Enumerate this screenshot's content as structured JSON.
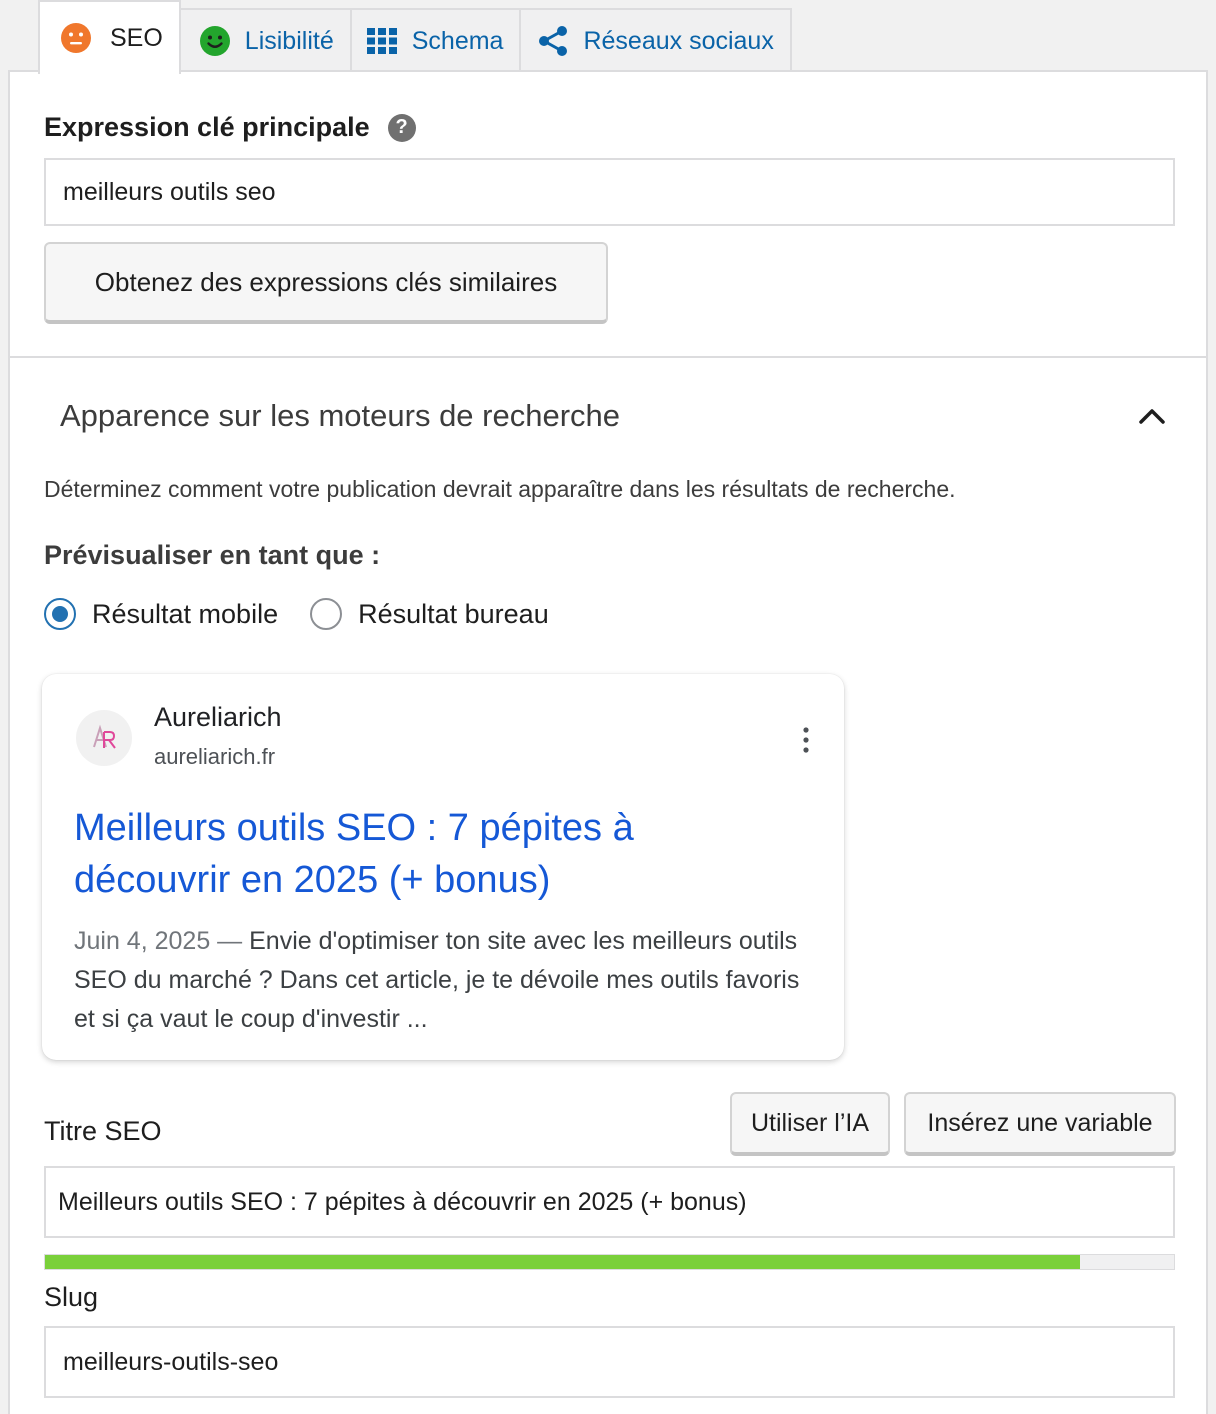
{
  "tabs": [
    {
      "label": "SEO",
      "icon": "orange-neutral-face-icon",
      "active": true
    },
    {
      "label": "Lisibilité",
      "icon": "green-smiley-face-icon",
      "active": false
    },
    {
      "label": "Schema",
      "icon": "grid-icon",
      "active": false
    },
    {
      "label": "Réseaux sociaux",
      "icon": "share-icon",
      "active": false
    }
  ],
  "focus_keyphrase": {
    "label": "Expression clé principale",
    "help_icon": "question-mark-icon",
    "value": "meilleurs outils seo",
    "related_button": "Obtenez des expressions clés similaires"
  },
  "search_appearance": {
    "title": "Apparence sur les moteurs de recherche",
    "collapse_icon": "chevron-up-icon",
    "description": "Déterminez comment votre publication devrait apparaître dans les résultats de recherche.",
    "preview_label": "Prévisualiser en tant que :",
    "radio_mobile": "Résultat mobile",
    "radio_desktop": "Résultat bureau",
    "selected": "mobile"
  },
  "preview": {
    "site_name": "Aureliarich",
    "site_url": "aureliarich.fr",
    "favicon_text": "AR",
    "menu_icon": "kebab-menu-icon",
    "link_title": "Meilleurs outils SEO : 7 pépites à découvrir en 2025 (+ bonus)",
    "date": "Juin 4, 2025",
    "separator": "—",
    "snippet": "Envie d'optimiser ton site avec les meilleurs outils SEO du marché ? Dans cet article, je te dévoile mes outils favoris et si ça vaut le coup d'investir ..."
  },
  "seo_title": {
    "label": "Titre SEO",
    "ai_button": "Utiliser l’IA",
    "variable_button": "Insérez une variable",
    "value": "Meilleurs outils SEO : 7 pépites à découvrir en 2025 (+ bonus)",
    "progress_percent": 91.7,
    "progress_color": "#7ad03a"
  },
  "slug": {
    "label": "Slug",
    "value": "meilleurs-outils-seo"
  },
  "colors": {
    "accent": "#2271b1",
    "link": "#1558d6",
    "tab_link": "#0a63a8",
    "neutral_face": "#f0772c",
    "good_face": "#23a52d"
  }
}
